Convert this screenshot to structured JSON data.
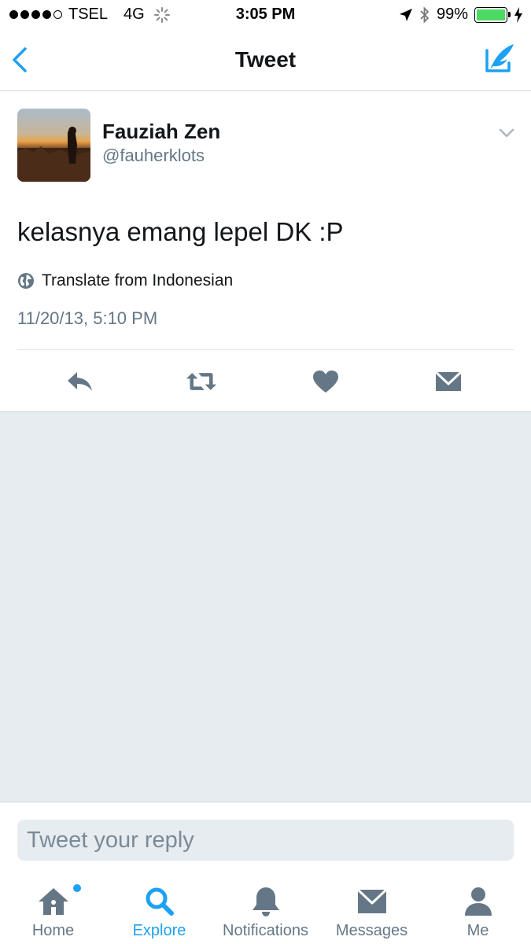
{
  "status_bar": {
    "carrier": "TSEL",
    "network": "4G",
    "time": "3:05 PM",
    "battery": "99%",
    "battery_level": 0.99
  },
  "nav": {
    "title": "Tweet",
    "back_icon": "chevron-left-icon",
    "compose_icon": "compose-tweet-icon"
  },
  "tweet": {
    "display_name": "Fauziah Zen",
    "handle": "@fauherklots",
    "text": "kelasnya emang lepel DK :P",
    "translate_label": "Translate from Indonesian",
    "timestamp": "11/20/13, 5:10 PM"
  },
  "reply": {
    "placeholder": "Tweet your reply"
  },
  "tabs": [
    {
      "label": "Home",
      "icon": "home-icon",
      "active": false
    },
    {
      "label": "Explore",
      "icon": "search-icon",
      "active": true
    },
    {
      "label": "Notifications",
      "icon": "bell-icon",
      "active": false
    },
    {
      "label": "Messages",
      "icon": "envelope-icon",
      "active": false
    },
    {
      "label": "Me",
      "icon": "person-icon",
      "active": false
    }
  ],
  "colors": {
    "accent": "#1da1f2",
    "icon_gray": "#657786",
    "background_gray": "#e6ecf0"
  }
}
